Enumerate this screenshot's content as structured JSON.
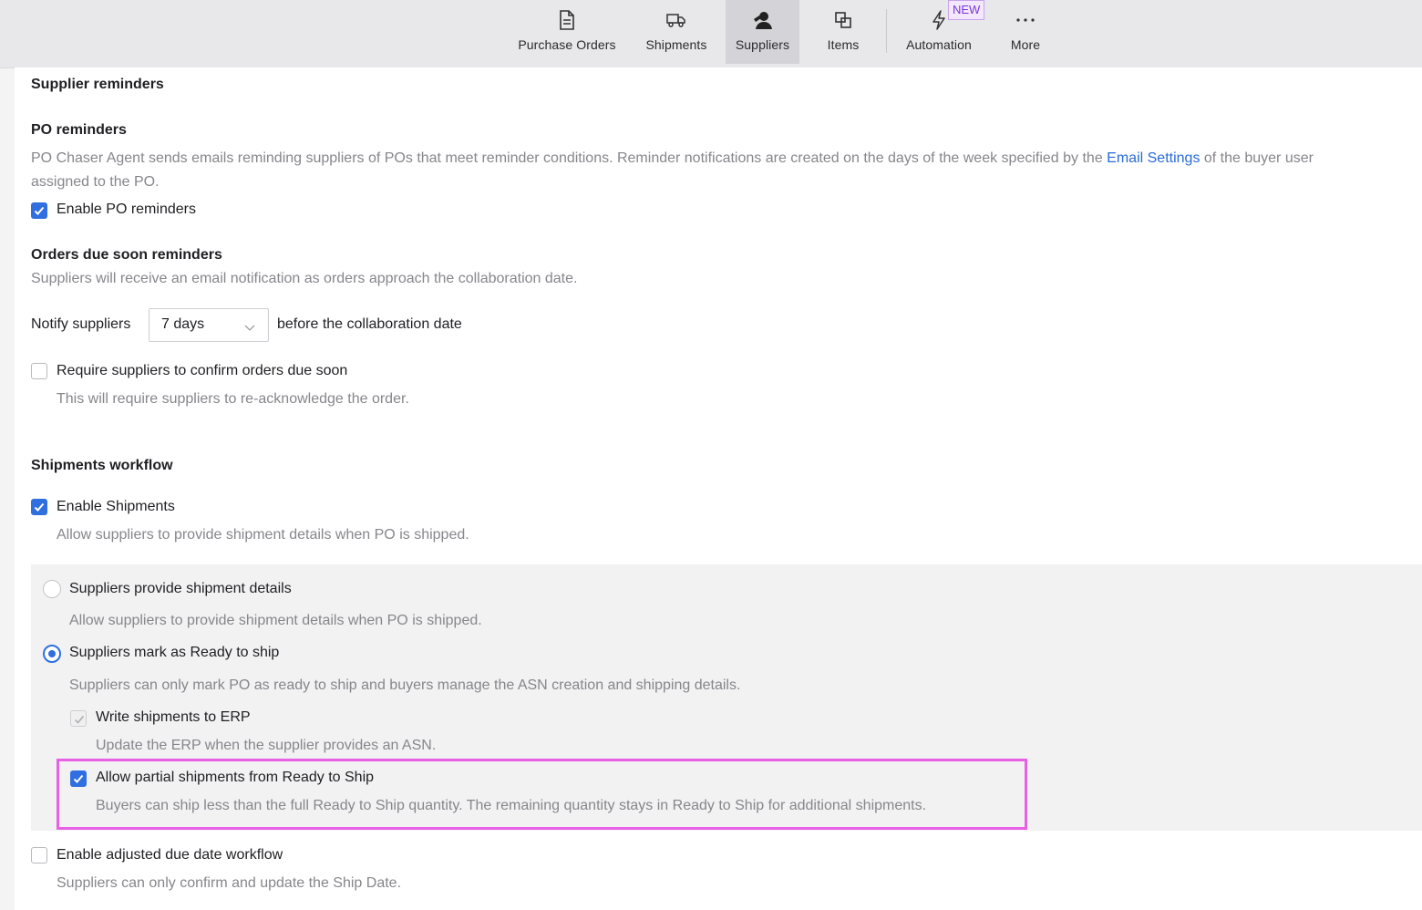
{
  "nav": {
    "items": [
      {
        "label": "Purchase Orders",
        "icon": "document-icon"
      },
      {
        "label": "Shipments",
        "icon": "truck-icon"
      },
      {
        "label": "Suppliers",
        "icon": "supplier-icon",
        "active": true
      },
      {
        "label": "Items",
        "icon": "items-icon"
      },
      {
        "label": "Automation",
        "icon": "lightning-icon"
      },
      {
        "label": "More",
        "icon": "ellipsis-icon"
      }
    ],
    "badge": "NEW"
  },
  "section_title": "Supplier reminders",
  "po_reminders": {
    "title": "PO reminders",
    "desc_before": "PO Chaser Agent sends emails reminding suppliers of POs that meet reminder conditions. Reminder notifications are created on the days of the week specified by the ",
    "desc_link": "Email Settings",
    "desc_after": " of the buyer user",
    "desc_line2": "assigned to the PO.",
    "enable_label": "Enable PO reminders",
    "enabled": true
  },
  "due_soon": {
    "title": "Orders due soon reminders",
    "desc": "Suppliers will receive an email notification as orders approach the collaboration date.",
    "notify_prefix": "Notify suppliers",
    "notify_value": "7 days",
    "notify_suffix": "before the collaboration date",
    "require_label": "Require suppliers to confirm orders due soon",
    "require_desc": "This will require suppliers to re-acknowledge the order.",
    "require_checked": false
  },
  "shipments": {
    "title": "Shipments workflow",
    "enable_label": "Enable Shipments",
    "enable_desc": "Allow suppliers to provide shipment details when PO is shipped.",
    "enabled": true,
    "option1_label": "Suppliers provide shipment details",
    "option1_desc": "Allow suppliers to provide shipment details when PO is shipped.",
    "option2_label": "Suppliers mark as Ready to ship",
    "option2_desc": "Suppliers can only mark PO as ready to ship and buyers manage the ASN creation and shipping details.",
    "write_erp_label": "Write shipments to ERP",
    "write_erp_desc": "Update the ERP when the supplier provides an ASN.",
    "partial_label": "Allow partial shipments from Ready to Ship",
    "partial_desc": "Buyers can ship less than the full Ready to Ship quantity. The remaining quantity stays in Ready to Ship for additional shipments."
  },
  "adjusted": {
    "label": "Enable adjusted due date workflow",
    "desc": "Suppliers can only confirm and update the Ship Date.",
    "checked": false
  },
  "colors": {
    "accent": "#2f6fdf",
    "highlight": "#e760e6"
  }
}
